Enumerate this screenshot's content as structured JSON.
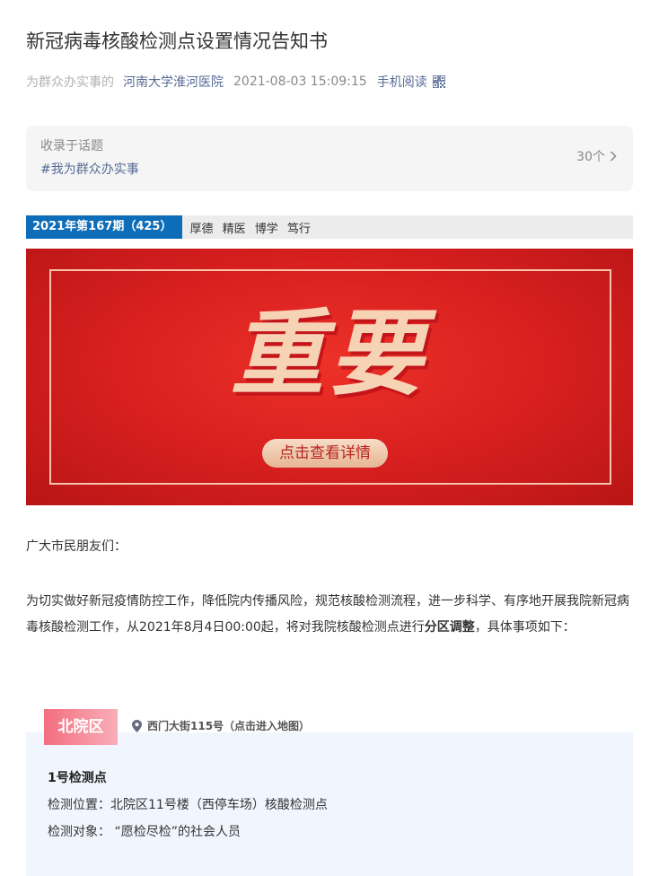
{
  "article": {
    "title": "新冠病毒核酸检测点设置情况告知书",
    "source_prefix": "为群众办实事的",
    "account": "河南大学淮河医院",
    "datetime": "2021-08-03 15:09:15",
    "mobile_read": "手机阅读",
    "qr_icon": "qrcode-icon"
  },
  "topic": {
    "label": "收录于话题",
    "tag": "#我为群众办实事",
    "count": "30个"
  },
  "issue": {
    "number": "2021年第167期（425）",
    "motto": "厚德 精医 博学 笃行"
  },
  "banner": {
    "headline": "重要",
    "button": "点击查看详情",
    "colors": {
      "bg": "#d51e1e",
      "text": "#f7d3b6"
    }
  },
  "body": {
    "greeting": "广大市民朋友们：",
    "para_before": "为切实做好新冠疫情防控工作，降低院内传播风险，规范核酸检测流程，进一步科学、有序地开展我院新冠病毒核酸检测工作，从2021年8月4日00:00起，将对我院核酸检测点进行",
    "para_bold": "分区调整",
    "para_after": "，具体事项如下："
  },
  "district": {
    "name": "北院区",
    "address": "西门大街115号（点击进入地图）",
    "site_title": "1号检测点",
    "location": "检测位置：北院区11号楼（西停车场）核酸检测点",
    "target": "检测对象：  “愿检尽检”的社会人员"
  }
}
